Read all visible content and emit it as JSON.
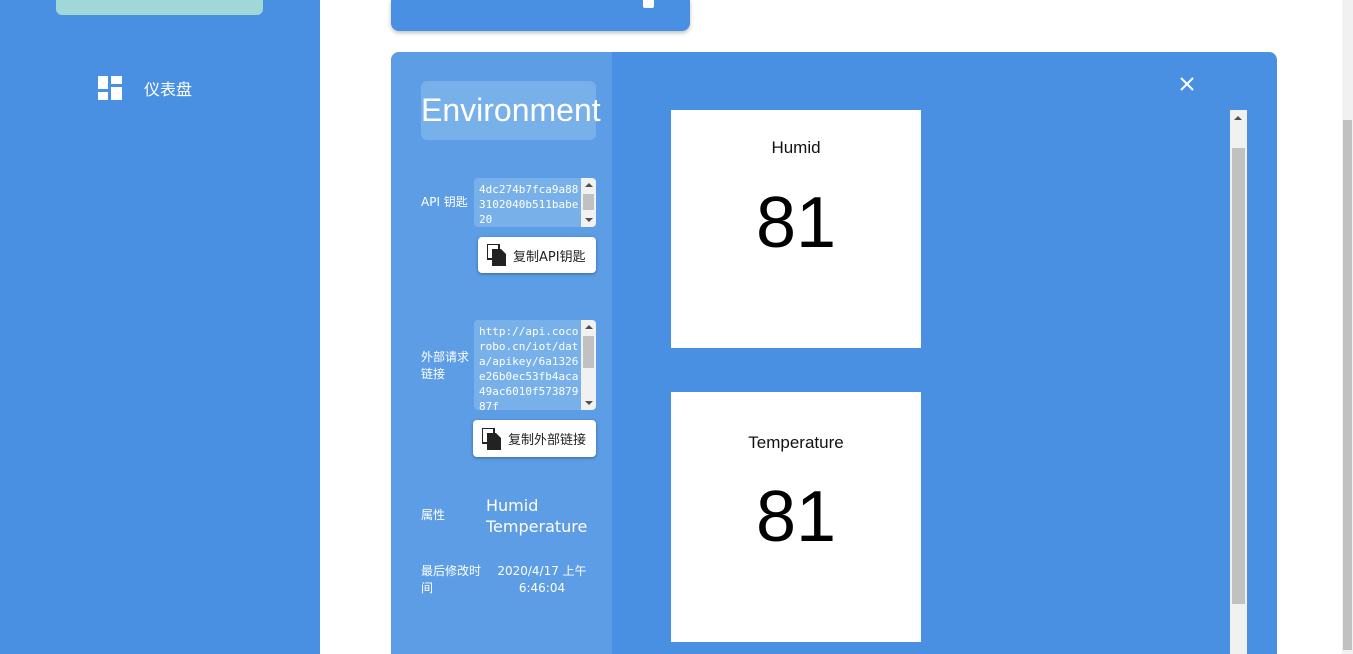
{
  "sidebar": {
    "nav_items": [
      {
        "label": "仪表盘",
        "icon": "dashboard-icon"
      }
    ]
  },
  "device": {
    "title": "Environment",
    "api_key_label": "API 钥匙",
    "api_key_value": "4dc274b7fca9a883102040b511babe20",
    "copy_api_key_label": "复制API钥匙",
    "external_link_label": "外部请求链接",
    "external_link_value": "http://api.cocorobo.cn/iot/data/apikey/6a1326e26b0ec53fb4aca49ac6010f57387987f",
    "copy_external_link_label": "复制外部链接",
    "properties_label": "属性",
    "properties": [
      "Humid",
      "Temperature"
    ],
    "modified_label": "最后修改时间",
    "modified_value": "2020/4/17 上午6:46:04"
  },
  "tiles": [
    {
      "name": "Humid",
      "value": "81"
    },
    {
      "name": "Temperature",
      "value": "81"
    }
  ],
  "colors": {
    "primary": "#4a90e2",
    "panel": "#5d9de5",
    "panel_light": "#78b0ea",
    "accent_teal": "#9fd8d6"
  }
}
